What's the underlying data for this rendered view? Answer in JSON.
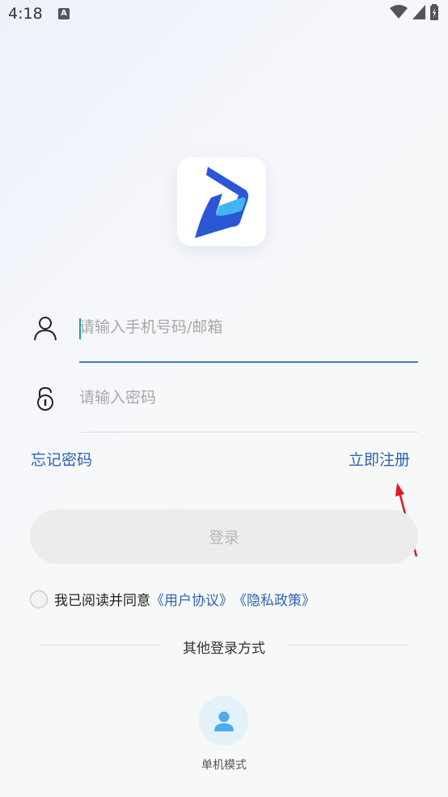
{
  "status_bar": {
    "time": "4:18",
    "notification_letter": "A"
  },
  "app": {
    "logo_icon": "app-logo-icon",
    "brand_colors": {
      "blue": "#2b57d6",
      "cyan": "#3fb6f0"
    }
  },
  "form": {
    "account_placeholder": "请输入手机号码/邮箱",
    "password_placeholder": "请输入密码",
    "forgot_password": "忘记密码",
    "register": "立即注册",
    "login_button": "登录"
  },
  "agreement": {
    "prefix": "我已阅读并同意",
    "user_agreement": "《用户协议》",
    "privacy_policy": "《隐私政策》"
  },
  "other_login": {
    "title": "其他登录方式",
    "options": [
      {
        "label": "单机模式",
        "icon": "user-icon"
      }
    ]
  },
  "colors": {
    "accent": "#2f64b4",
    "annotation_arrow": "#e0191d"
  }
}
